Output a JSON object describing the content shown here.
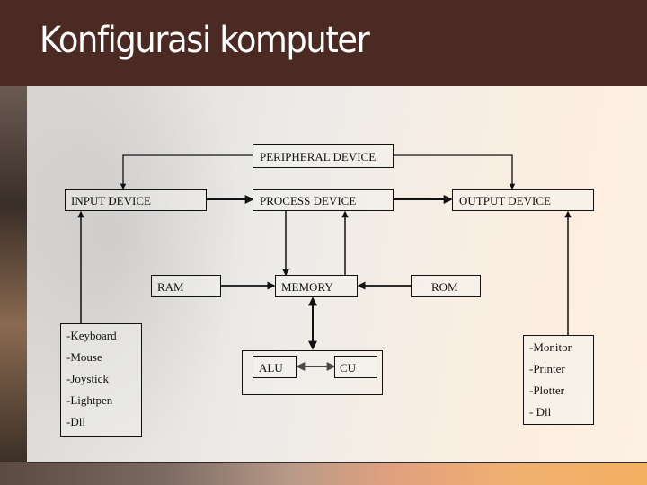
{
  "slide": {
    "title": "Konfigurasi komputer"
  },
  "diagram": {
    "nodes": {
      "peripheral": "PERIPHERAL DEVICE",
      "input": "INPUT DEVICE",
      "process": "PROCESS DEVICE",
      "output": "OUTPUT DEVICE",
      "ram": "RAM",
      "memory": "MEMORY",
      "rom": "ROM",
      "alu": "ALU",
      "cu": "CU"
    },
    "input_devices": [
      "-Keyboard",
      "-Mouse",
      "-Joystick",
      "-Lightpen",
      "-Dll"
    ],
    "output_devices": [
      "-Monitor",
      "-Printer",
      "-Plotter",
      "- Dll"
    ],
    "edges": [
      {
        "from": "PERIPHERAL DEVICE",
        "to": "INPUT DEVICE"
      },
      {
        "from": "PERIPHERAL DEVICE",
        "to": "OUTPUT DEVICE"
      },
      {
        "from": "INPUT DEVICE",
        "to": "PROCESS DEVICE"
      },
      {
        "from": "PROCESS DEVICE",
        "to": "OUTPUT DEVICE"
      },
      {
        "from": "PROCESS DEVICE",
        "to": "MEMORY"
      },
      {
        "from": "MEMORY",
        "to": "PROCESS DEVICE"
      },
      {
        "from": "RAM",
        "to": "MEMORY"
      },
      {
        "from": "ROM",
        "to": "MEMORY"
      },
      {
        "from": "MEMORY",
        "to": "ALU/CU",
        "bidirectional": true
      },
      {
        "from": "ALU",
        "to": "CU",
        "bidirectional": true
      },
      {
        "from": "Input list",
        "to": "INPUT DEVICE"
      },
      {
        "from": "Output list",
        "to": "OUTPUT DEVICE"
      }
    ]
  }
}
